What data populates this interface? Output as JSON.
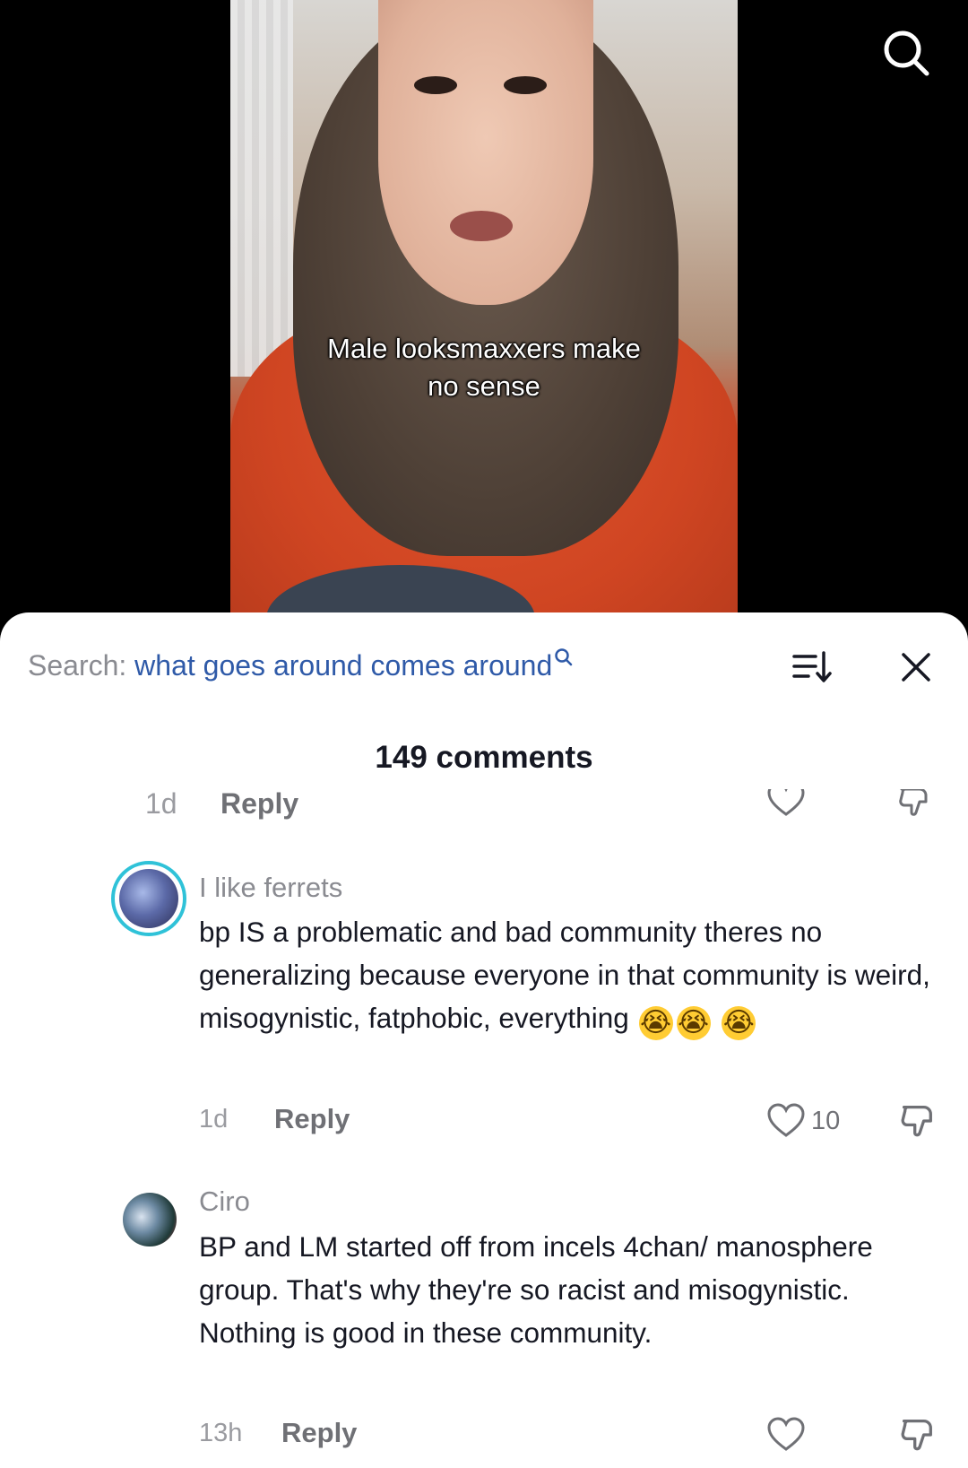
{
  "video": {
    "caption_line1": "Male looksmaxxers make",
    "caption_line2": "no sense"
  },
  "sheet": {
    "search_prefix": "Search:",
    "search_query": "what goes around comes around",
    "comment_count": "149 comments"
  },
  "clipped_row": {
    "time": "1d",
    "reply": "Reply"
  },
  "comments": [
    {
      "username": "I like ferrets",
      "text": "bp IS a problematic and bad community theres no generalizing because everyone in that community is weird, misogynistic, fatphobic, everything",
      "emoji": "😭",
      "time": "1d",
      "reply": "Reply",
      "likes": "10"
    },
    {
      "username": "Ciro",
      "text": "BP and LM started off from incels 4chan/ manosphere group. That's why they're so racist and misogynistic. Nothing is good in these community.",
      "time": "13h",
      "reply": "Reply"
    }
  ],
  "colors": {
    "query_blue": "#2f5aa8",
    "muted": "#8a8b91",
    "text": "#161823",
    "avatar_ring": "#2fc2d8"
  },
  "icons": [
    "search-icon",
    "sort-icon",
    "close-icon",
    "heart-icon",
    "dislike-icon"
  ]
}
